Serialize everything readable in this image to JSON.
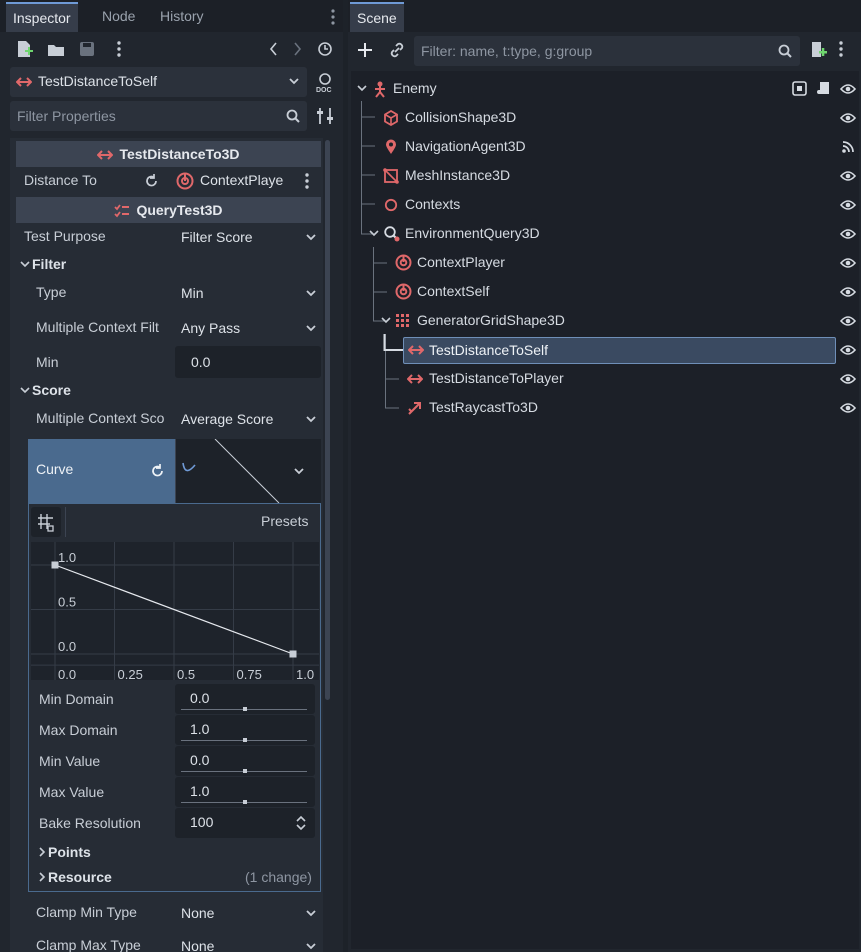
{
  "inspector": {
    "tabs": [
      "Inspector",
      "Node",
      "History"
    ],
    "object_name": "TestDistanceToSelf",
    "filter_placeholder": "Filter Properties",
    "section1_title": "TestDistanceTo3D",
    "distance_to_label": "Distance To",
    "distance_to_value": "ContextPlaye",
    "section2_title": "QueryTest3D",
    "test_purpose_label": "Test Purpose",
    "test_purpose_value": "Filter Score",
    "filter_cat": "Filter",
    "type_label": "Type",
    "type_value": "Min",
    "mcf_label": "Multiple Context Filt",
    "mcf_value": "Any Pass",
    "min_label": "Min",
    "min_value": "0.0",
    "score_cat": "Score",
    "mcs_label": "Multiple Context Sco",
    "mcs_value": "Average Score",
    "curve_label": "Curve",
    "presets_label": "Presets",
    "curve": {
      "y_ticks": [
        "1.0",
        "0.5",
        "0.0"
      ],
      "x_ticks": [
        "0.0",
        "0.25",
        "0.5",
        "0.75",
        "1.0"
      ],
      "points": [
        [
          0.0,
          1.0
        ],
        [
          1.0,
          0.0
        ]
      ]
    },
    "min_domain_label": "Min Domain",
    "min_domain_value": "0.0",
    "max_domain_label": "Max Domain",
    "max_domain_value": "1.0",
    "min_value_label": "Min Value",
    "min_value_value": "0.0",
    "max_value_label": "Max Value",
    "max_value_value": "1.0",
    "bake_label": "Bake Resolution",
    "bake_value": "100",
    "points_cat": "Points",
    "resource_cat": "Resource",
    "resource_note": "(1 change)",
    "clamp_min_label": "Clamp Min Type",
    "clamp_min_value": "None",
    "clamp_max_label": "Clamp Max Type",
    "clamp_max_value": "None"
  },
  "scene": {
    "tab": "Scene",
    "filter_placeholder": "Filter: name, t:type, g:group",
    "nodes": [
      {
        "name": "Enemy",
        "icon": "skeleton-icon"
      },
      {
        "name": "CollisionShape3D",
        "icon": "box-icon"
      },
      {
        "name": "NavigationAgent3D",
        "icon": "pin-icon"
      },
      {
        "name": "MeshInstance3D",
        "icon": "mesh-icon"
      },
      {
        "name": "Contexts",
        "icon": "circle-icon"
      },
      {
        "name": "EnvironmentQuery3D",
        "icon": "query-icon"
      },
      {
        "name": "ContextPlayer",
        "icon": "context-icon"
      },
      {
        "name": "ContextSelf",
        "icon": "context-icon"
      },
      {
        "name": "GeneratorGridShape3D",
        "icon": "grid-icon"
      },
      {
        "name": "TestDistanceToSelf",
        "icon": "distance-icon"
      },
      {
        "name": "TestDistanceToPlayer",
        "icon": "distance-icon"
      },
      {
        "name": "TestRaycastTo3D",
        "icon": "raycast-icon"
      }
    ]
  },
  "colors": {
    "accent": "#6f9ad6",
    "node_icon": "#e0686a",
    "curve_header": "#4a6a8e"
  }
}
